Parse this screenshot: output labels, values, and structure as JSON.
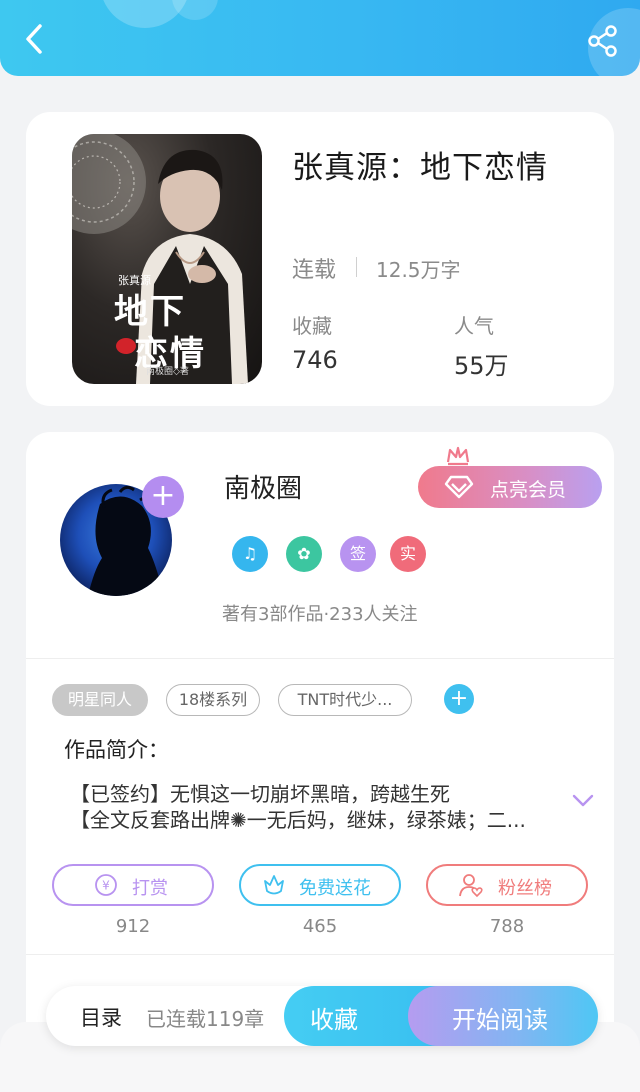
{
  "header": {
    "back_icon": "chevron-left-icon",
    "share_icon": "share-icon",
    "color": "#38b8f2"
  },
  "book": {
    "title": "张真源：地下恋情",
    "status": "连载",
    "word_count": "12.5万字",
    "favorites_label": "收藏",
    "favorites_value": "746",
    "popularity_label": "人气",
    "popularity_value": "55万",
    "cover": {
      "top_name": "张真源",
      "title_line1": "地下",
      "title_line2": "恋情",
      "author_credit": "南极圈◇著"
    }
  },
  "author": {
    "name": "南极圈",
    "vip_button": "点亮会员",
    "badges": [
      {
        "icon": "music-note-icon",
        "color": "#35b6ee"
      },
      {
        "icon": "gift-icon",
        "color": "#3cc6a0"
      },
      {
        "text": "签",
        "color": "#b893f0"
      },
      {
        "text": "实",
        "color": "#f06b7a"
      }
    ],
    "meta": "著有3部作品·233人关注"
  },
  "tags": [
    "明星同人",
    "18楼系列",
    "TNT时代少..."
  ],
  "intro": {
    "heading": "作品简介：",
    "lines": [
      "【已签约】无惧这一切崩坏黑暗，跨越生死",
      "【全文反套路出牌✺一无后妈，继妹，绿茶婊；二..."
    ]
  },
  "actions": [
    {
      "label": "打赏",
      "count": "912",
      "color": "#b893f0",
      "icon": "yen-icon"
    },
    {
      "label": "免费送花",
      "count": "465",
      "color": "#3fc0ef",
      "icon": "flower-icon"
    },
    {
      "label": "粉丝榜",
      "count": "788",
      "color": "#f07c7c",
      "icon": "user-heart-icon"
    }
  ],
  "bottom_bar": {
    "toc": "目录",
    "chapters": "已连载119章",
    "collect": "收藏",
    "read": "开始阅读"
  }
}
